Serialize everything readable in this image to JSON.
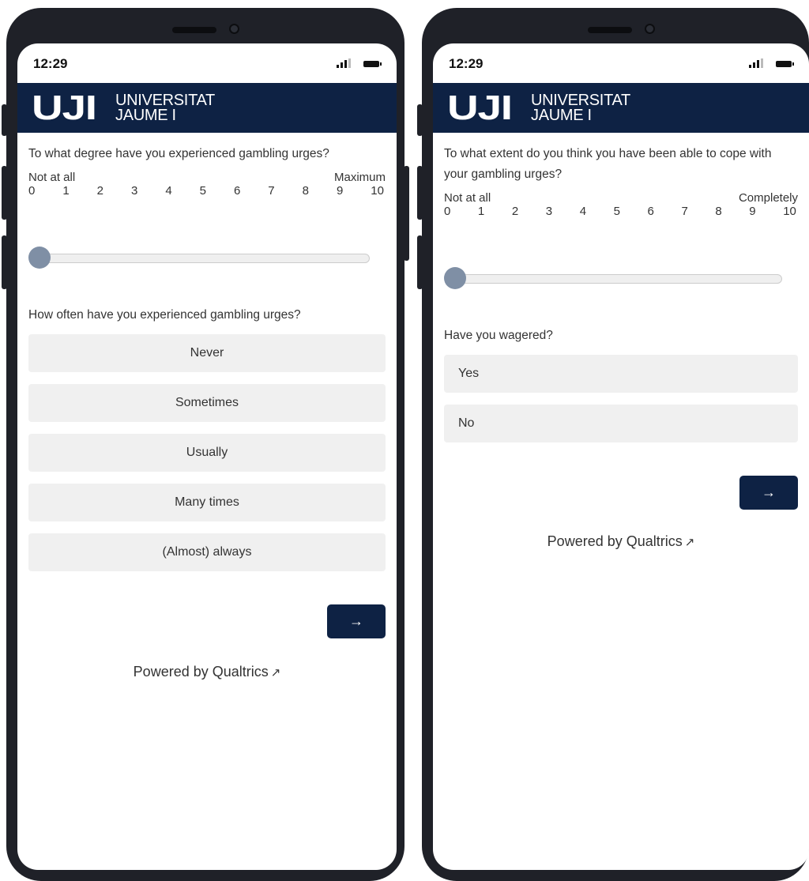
{
  "left_phone": {
    "status_time": "12:29",
    "logo": {
      "mark": "UJI",
      "line1": "UNIVERSITAT",
      "line2": "JAUME I"
    },
    "question1": "To what degree have you experienced gambling urges?",
    "scale_min_label": "Not at all",
    "scale_max_label": "Maximum",
    "ticks": [
      "0",
      "1",
      "2",
      "3",
      "4",
      "5",
      "6",
      "7",
      "8",
      "9",
      "10"
    ],
    "slider_value": 0,
    "question2": "How often have you experienced gambling urges?",
    "options": [
      "Never",
      "Sometimes",
      "Usually",
      "Many times",
      "(Almost) always"
    ],
    "next_label": "→",
    "powered_by": "Powered by Qualtrics"
  },
  "right_phone": {
    "status_time": "12:29",
    "logo": {
      "mark": "UJI",
      "line1": "UNIVERSITAT",
      "line2": "JAUME I"
    },
    "question1": "To what extent do you think you have been able to cope with your gambling urges?",
    "scale_min_label": "Not at all",
    "scale_max_label": "Completely",
    "ticks": [
      "0",
      "1",
      "2",
      "3",
      "4",
      "5",
      "6",
      "7",
      "8",
      "9",
      "10"
    ],
    "slider_value": 0,
    "question2": "Have you wagered?",
    "options": [
      "Yes",
      "No"
    ],
    "next_label": "→",
    "powered_by": "Powered by Qualtrics"
  },
  "icons": {
    "signal": "signal-bars-icon",
    "battery": "battery-icon",
    "external": "external-link-icon"
  },
  "colors": {
    "brand_navy": "#0e2244",
    "option_bg": "#f0f0f0",
    "slider_thumb": "#7f8fa5"
  }
}
